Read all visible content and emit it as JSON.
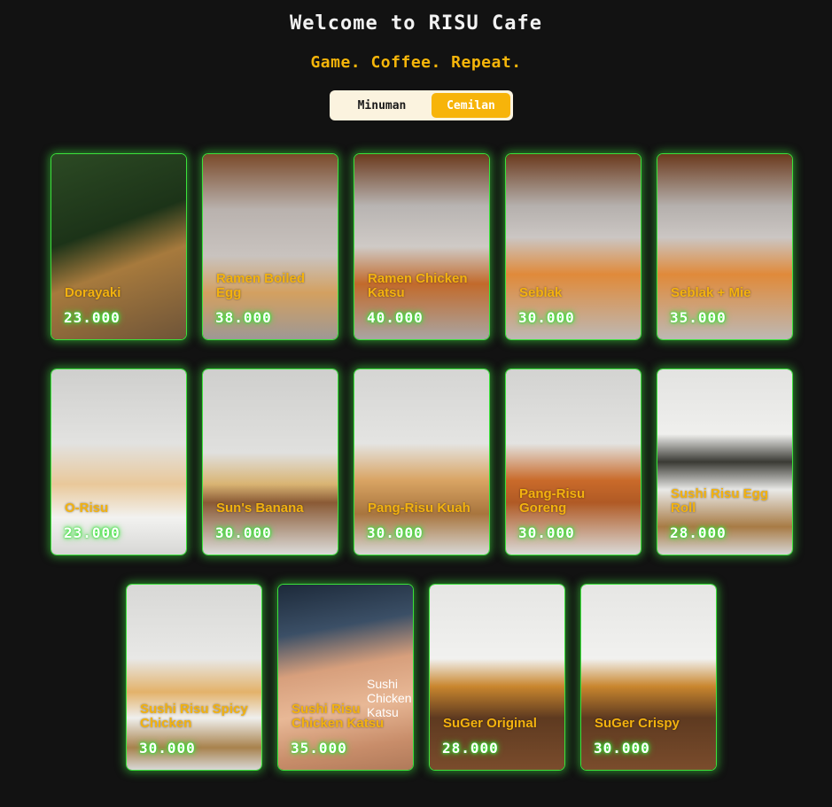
{
  "header": {
    "title": "Welcome to RISU Cafe",
    "subtitle": "Game. Coffee. Repeat."
  },
  "tabs": {
    "minuman": "Minuman",
    "cemilan": "Cemilan",
    "active": "Cemilan"
  },
  "colors": {
    "background": "#121212",
    "accent_yellow": "#f7b40a",
    "glow_green": "#3be23b"
  },
  "menu": [
    {
      "name": "Dorayaki",
      "price": "23.000"
    },
    {
      "name": "Ramen Boiled Egg",
      "price": "38.000"
    },
    {
      "name": "Ramen Chicken Katsu",
      "price": "40.000"
    },
    {
      "name": "Seblak",
      "price": "30.000"
    },
    {
      "name": "Seblak + Mie",
      "price": "35.000"
    },
    {
      "name": "O-Risu",
      "price": "23.000"
    },
    {
      "name": "Sun's Banana",
      "price": "30.000"
    },
    {
      "name": "Pang-Risu Kuah",
      "price": "30.000"
    },
    {
      "name": "Pang-Risu Goreng",
      "price": "30.000"
    },
    {
      "name": "Sushi Risu Egg Roll",
      "price": "28.000"
    },
    {
      "name": "Sushi Risu Spicy Chicken",
      "price": "30.000"
    },
    {
      "name": "Sushi Risu Chicken Katsu",
      "price": "35.000",
      "overlay": "Sushi Chicken Katsu"
    },
    {
      "name": "SuGer Original",
      "price": "28.000"
    },
    {
      "name": "SuGer Crispy",
      "price": "30.000"
    }
  ]
}
